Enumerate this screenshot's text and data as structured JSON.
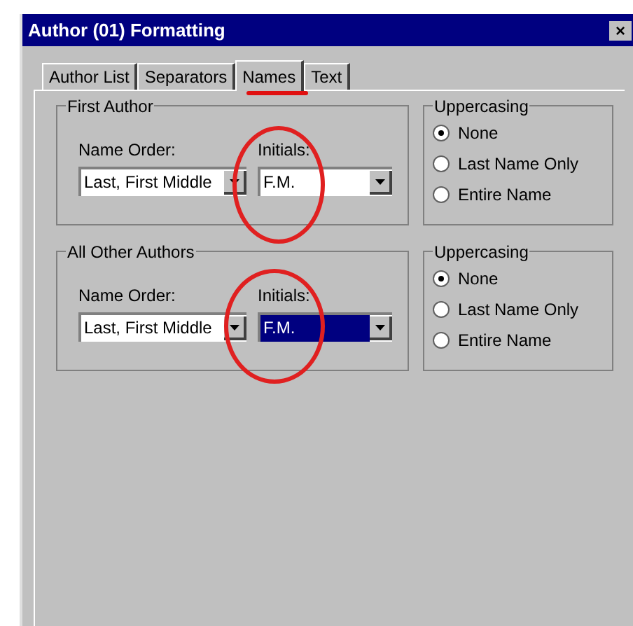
{
  "window": {
    "title": "Author (01) Formatting",
    "close": "×"
  },
  "tabs": [
    {
      "label": "Author List",
      "selected": false
    },
    {
      "label": "Separators",
      "selected": false
    },
    {
      "label": "Names",
      "selected": true
    },
    {
      "label": "Text",
      "selected": false
    }
  ],
  "sections": [
    {
      "title": "First Author",
      "name_order": {
        "label": "Name Order:",
        "value": "Last, First Middle",
        "highlighted": false
      },
      "initials": {
        "label": "Initials:",
        "value": "F.M.",
        "highlighted": false
      },
      "uppercasing": {
        "title": "Uppercasing",
        "options": [
          {
            "label": "None",
            "selected": true
          },
          {
            "label": "Last Name Only",
            "selected": false
          },
          {
            "label": "Entire Name",
            "selected": false
          }
        ]
      }
    },
    {
      "title": "All Other Authors",
      "name_order": {
        "label": "Name Order:",
        "value": "Last, First Middle",
        "highlighted": false
      },
      "initials": {
        "label": "Initials:",
        "value": "F.M.",
        "highlighted": true
      },
      "uppercasing": {
        "title": "Uppercasing",
        "options": [
          {
            "label": "None",
            "selected": true
          },
          {
            "label": "Last Name Only",
            "selected": false
          },
          {
            "label": "Entire Name",
            "selected": false
          }
        ]
      }
    }
  ]
}
